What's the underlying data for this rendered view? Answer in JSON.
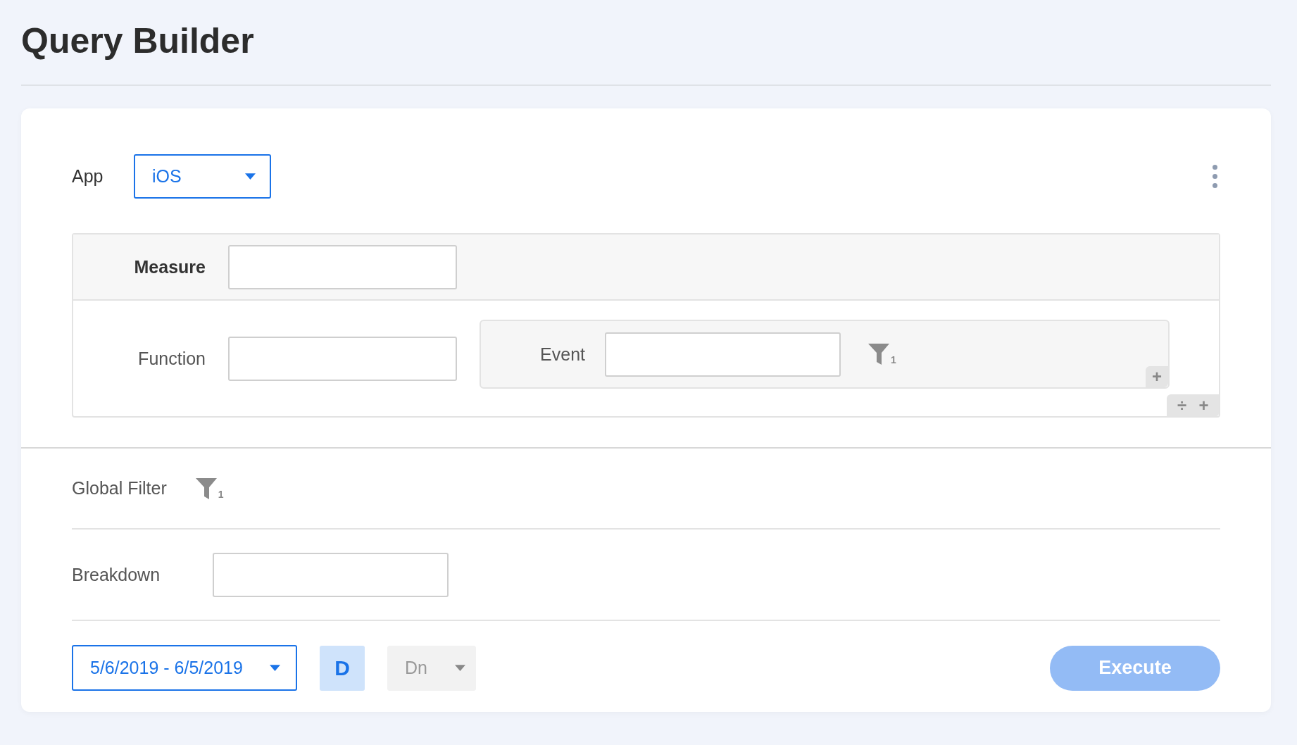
{
  "title": "Query Builder",
  "app": {
    "label": "App",
    "value": "iOS"
  },
  "measure": {
    "label": "Measure",
    "rows": [
      {
        "function": {
          "label": "Function"
        },
        "event": {
          "label": "Event",
          "filter_count": "1",
          "add": "+"
        }
      }
    ],
    "actions": [
      "÷",
      "+"
    ]
  },
  "global_filter": {
    "label": "Global Filter",
    "filter_count": "1"
  },
  "breakdown": {
    "label": "Breakdown"
  },
  "footer": {
    "date_range": "5/6/2019 - 6/5/2019",
    "granularity": {
      "label": "D",
      "selected": true
    },
    "interval": {
      "label": "Dn",
      "disabled": true
    },
    "execute": {
      "label": "Execute",
      "disabled": true
    }
  }
}
